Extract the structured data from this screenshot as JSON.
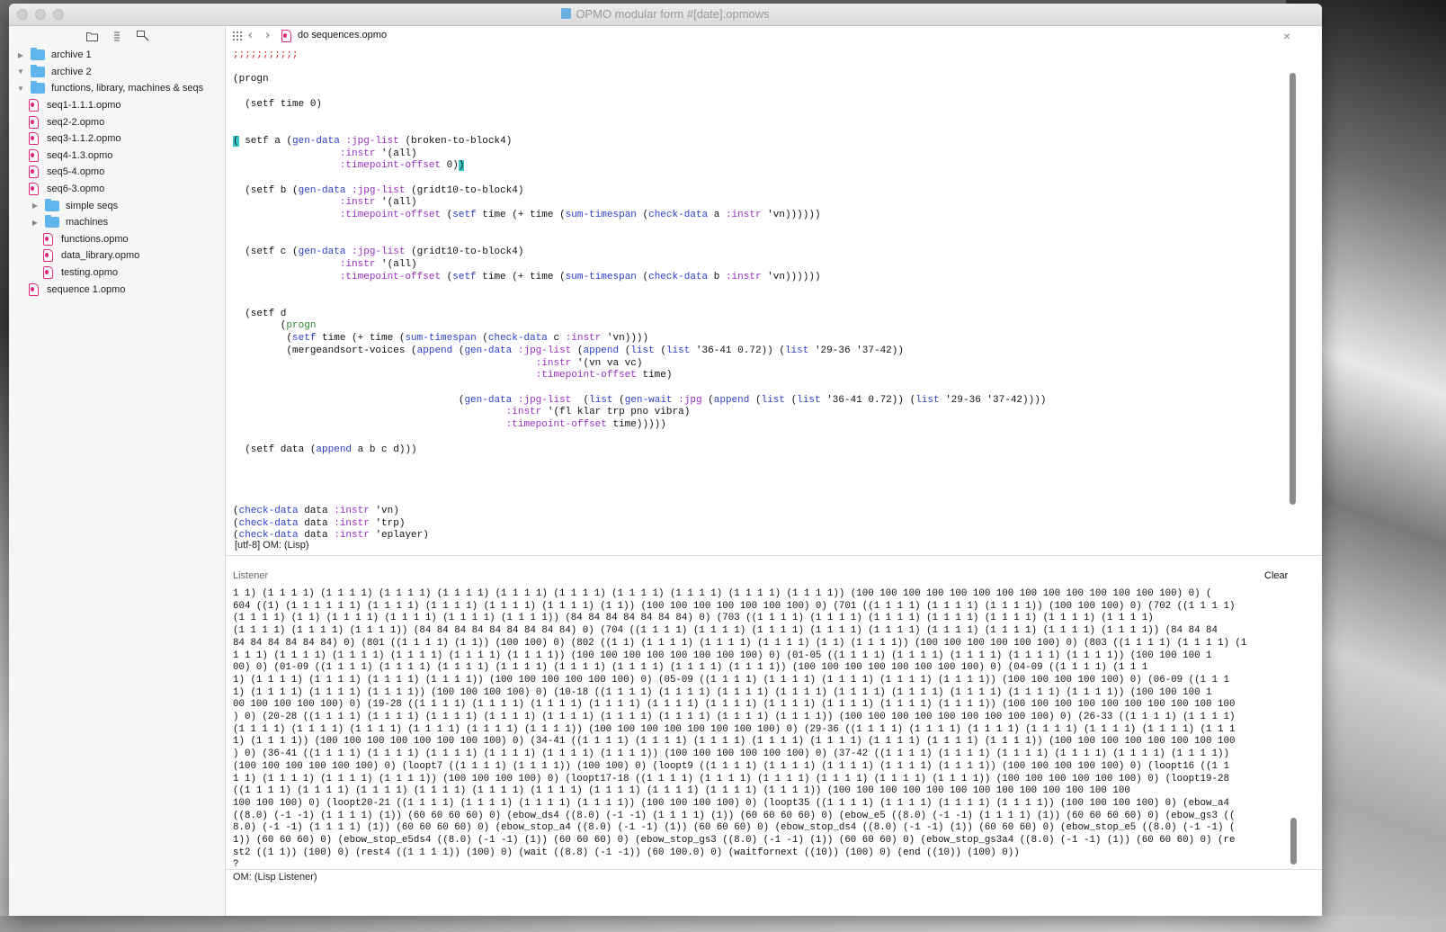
{
  "window": {
    "title": "OPMO modular form #[date].opmows"
  },
  "sidebar": {
    "tools": [
      "folder-icon",
      "list-icon",
      "search-icon"
    ],
    "items": [
      {
        "label": "archive 1",
        "type": "folder",
        "level": 0,
        "expanded": false
      },
      {
        "label": "archive 2",
        "type": "folder",
        "level": 0,
        "expanded": true
      },
      {
        "label": "functions, library, machines & seqs",
        "type": "folder",
        "level": 0,
        "expanded": true
      },
      {
        "label": "seq1-1.1.1.opmo",
        "type": "file",
        "level": 1
      },
      {
        "label": "seq2-2.opmo",
        "type": "file",
        "level": 1
      },
      {
        "label": "seq3-1.1.2.opmo",
        "type": "file",
        "level": 1
      },
      {
        "label": "seq4-1.3.opmo",
        "type": "file",
        "level": 1
      },
      {
        "label": "seq5-4.opmo",
        "type": "file",
        "level": 1
      },
      {
        "label": "seq6-3.opmo",
        "type": "file",
        "level": 1
      },
      {
        "label": "simple seqs",
        "type": "folder",
        "level": 1,
        "expanded": false
      },
      {
        "label": "machines",
        "type": "folder",
        "level": 1,
        "expanded": false
      },
      {
        "label": "functions.opmo",
        "type": "file",
        "level": 2
      },
      {
        "label": "data_library.opmo",
        "type": "file",
        "level": 2
      },
      {
        "label": "testing.opmo",
        "type": "file",
        "level": 2
      },
      {
        "label": "sequence 1.opmo",
        "type": "file",
        "level": 0
      }
    ]
  },
  "editor": {
    "tab_title": "do sequences.opmo",
    "status": "[utf-8] OM:  (Lisp)",
    "code_lines": [
      [
        [
          "red",
          ";;;;;;;;;;;"
        ]
      ],
      [],
      [
        [
          "",
          "(progn"
        ]
      ],
      [],
      [
        [
          "",
          "  (setf time 0)"
        ]
      ],
      [],
      [],
      [
        [
          "hl",
          "("
        ],
        [
          "",
          " setf a ("
        ],
        [
          "blue",
          "gen-data"
        ],
        [
          "",
          " "
        ],
        [
          "kw",
          ":jpg-list"
        ],
        [
          "",
          " (broken-to-block4)"
        ]
      ],
      [
        [
          "",
          "                  "
        ],
        [
          "kw",
          ":instr"
        ],
        [
          "",
          " '(all)"
        ]
      ],
      [
        [
          "",
          "                  "
        ],
        [
          "kw",
          ":timepoint-offset"
        ],
        [
          "",
          " 0)"
        ],
        [
          "hl",
          ")"
        ]
      ],
      [],
      [
        [
          "",
          "  (setf b ("
        ],
        [
          "blue",
          "gen-data"
        ],
        [
          "",
          " "
        ],
        [
          "kw",
          ":jpg-list"
        ],
        [
          "",
          " (gridt10-to-block4)"
        ]
      ],
      [
        [
          "",
          "                  "
        ],
        [
          "kw",
          ":instr"
        ],
        [
          "",
          " '(all)"
        ]
      ],
      [
        [
          "",
          "                  "
        ],
        [
          "kw",
          ":timepoint-offset"
        ],
        [
          "",
          " ("
        ],
        [
          "blue",
          "setf"
        ],
        [
          "",
          " time (+ time ("
        ],
        [
          "blue",
          "sum-timespan"
        ],
        [
          "",
          " ("
        ],
        [
          "blue",
          "check-data"
        ],
        [
          "",
          " a "
        ],
        [
          "kw",
          ":instr"
        ],
        [
          "",
          " 'vn))))))"
        ]
      ],
      [],
      [],
      [
        [
          "",
          "  (setf c ("
        ],
        [
          "blue",
          "gen-data"
        ],
        [
          "",
          " "
        ],
        [
          "kw",
          ":jpg-list"
        ],
        [
          "",
          " (gridt10-to-block4)"
        ]
      ],
      [
        [
          "",
          "                  "
        ],
        [
          "kw",
          ":instr"
        ],
        [
          "",
          " '(all)"
        ]
      ],
      [
        [
          "",
          "                  "
        ],
        [
          "kw",
          ":timepoint-offset"
        ],
        [
          "",
          " ("
        ],
        [
          "blue",
          "setf"
        ],
        [
          "",
          " time (+ time ("
        ],
        [
          "blue",
          "sum-timespan"
        ],
        [
          "",
          " ("
        ],
        [
          "blue",
          "check-data"
        ],
        [
          "",
          " b "
        ],
        [
          "kw",
          ":instr"
        ],
        [
          "",
          " 'vn))))))"
        ]
      ],
      [],
      [],
      [
        [
          "",
          "  (setf d"
        ]
      ],
      [
        [
          "",
          "        ("
        ],
        [
          "green",
          "progn"
        ]
      ],
      [
        [
          "",
          "         ("
        ],
        [
          "blue",
          "setf"
        ],
        [
          "",
          " time (+ time ("
        ],
        [
          "blue",
          "sum-timespan"
        ],
        [
          "",
          " ("
        ],
        [
          "blue",
          "check-data"
        ],
        [
          "",
          " c "
        ],
        [
          "kw",
          ":instr"
        ],
        [
          "",
          " 'vn))))"
        ]
      ],
      [
        [
          "",
          "         (mergeandsort-voices ("
        ],
        [
          "blue",
          "append"
        ],
        [
          "",
          " ("
        ],
        [
          "blue",
          "gen-data"
        ],
        [
          "",
          " "
        ],
        [
          "kw",
          ":jpg-list"
        ],
        [
          "",
          " ("
        ],
        [
          "blue",
          "append"
        ],
        [
          "",
          " ("
        ],
        [
          "blue",
          "list"
        ],
        [
          "",
          " ("
        ],
        [
          "blue",
          "list"
        ],
        [
          "",
          " '36-41 0.72)) ("
        ],
        [
          "blue",
          "list"
        ],
        [
          "",
          " '29-36 '37-42))"
        ]
      ],
      [
        [
          "",
          "                                                   "
        ],
        [
          "kw",
          ":instr"
        ],
        [
          "",
          " '(vn va vc)"
        ]
      ],
      [
        [
          "",
          "                                                   "
        ],
        [
          "kw",
          ":timepoint-offset"
        ],
        [
          "",
          " time)"
        ]
      ],
      [],
      [
        [
          "",
          "                                      ("
        ],
        [
          "blue",
          "gen-data"
        ],
        [
          "",
          " "
        ],
        [
          "kw",
          ":jpg-list"
        ],
        [
          "",
          "  ("
        ],
        [
          "blue",
          "list"
        ],
        [
          "",
          " ("
        ],
        [
          "blue",
          "gen-wait"
        ],
        [
          "",
          " "
        ],
        [
          "kw",
          ":jpg"
        ],
        [
          "",
          " ("
        ],
        [
          "blue",
          "append"
        ],
        [
          "",
          " ("
        ],
        [
          "blue",
          "list"
        ],
        [
          "",
          " ("
        ],
        [
          "blue",
          "list"
        ],
        [
          "",
          " '36-41 0.72)) ("
        ],
        [
          "blue",
          "list"
        ],
        [
          "",
          " '29-36 '37-42))))"
        ]
      ],
      [
        [
          "",
          "                                              "
        ],
        [
          "kw",
          ":instr"
        ],
        [
          "",
          " '(fl klar trp pno vibra)"
        ]
      ],
      [
        [
          "",
          "                                              "
        ],
        [
          "kw",
          ":timepoint-offset"
        ],
        [
          "",
          " time)))))"
        ]
      ],
      [],
      [
        [
          "",
          "  (setf data ("
        ],
        [
          "blue",
          "append"
        ],
        [
          "",
          " a b c d)))"
        ]
      ],
      [],
      [],
      [],
      [],
      [
        [
          "",
          "("
        ],
        [
          "blue",
          "check-data"
        ],
        [
          "",
          " data "
        ],
        [
          "kw",
          ":instr"
        ],
        [
          "",
          " 'vn)"
        ]
      ],
      [
        [
          "",
          "("
        ],
        [
          "blue",
          "check-data"
        ],
        [
          "",
          " data "
        ],
        [
          "kw",
          ":instr"
        ],
        [
          "",
          " 'trp)"
        ]
      ],
      [
        [
          "",
          "("
        ],
        [
          "blue",
          "check-data"
        ],
        [
          "",
          " data "
        ],
        [
          "kw",
          ":instr"
        ],
        [
          "",
          " 'eplayer)"
        ]
      ]
    ]
  },
  "listener": {
    "title": "Listener",
    "clear_label": "Clear",
    "status": "OM:  (Lisp Listener)",
    "output": "1 1) (1 1 1 1) (1 1 1 1) (1 1 1 1) (1 1 1 1) (1 1 1 1) (1 1 1 1) (1 1 1 1) (1 1 1 1) (1 1 1 1) (1 1 1 1)) (100 100 100 100 100 100 100 100 100 100 100 100 100 100) 0) (\n604 ((1) (1 1 1 1 1 1) (1 1 1 1) (1 1 1 1) (1 1 1 1) (1 1 1 1) (1 1)) (100 100 100 100 100 100 100) 0) (701 ((1 1 1 1) (1 1 1 1) (1 1 1 1)) (100 100 100) 0) (702 ((1 1 1 1)\n(1 1 1 1) (1 1) (1 1 1 1) (1 1 1 1) (1 1 1 1) (1 1 1 1)) (84 84 84 84 84 84 84) 0) (703 ((1 1 1 1) (1 1 1 1) (1 1 1 1) (1 1 1 1) (1 1 1 1) (1 1 1 1) (1 1 1 1)\n(1 1 1 1) (1 1 1 1) (1 1 1 1)) (84 84 84 84 84 84 84 84 84) 0) (704 ((1 1 1 1) (1 1 1 1) (1 1 1 1) (1 1 1 1) (1 1 1 1) (1 1 1 1) (1 1 1 1) (1 1 1 1) (1 1 1 1)) (84 84 84\n84 84 84 84 84 84) 0) (801 ((1 1 1 1) (1 1)) (100 100) 0) (802 ((1 1) (1 1 1 1) (1 1 1 1) (1 1 1 1) (1 1) (1 1 1 1)) (100 100 100 100 100 100) 0) (803 ((1 1 1 1) (1 1 1 1) (1\n1 1 1) (1 1 1 1) (1 1 1 1) (1 1 1 1) (1 1 1 1) (1 1 1 1)) (100 100 100 100 100 100 100 100) 0) (01-05 ((1 1 1 1) (1 1 1 1) (1 1 1 1) (1 1 1 1) (1 1 1 1)) (100 100 100 1\n00) 0) (01-09 ((1 1 1 1) (1 1 1 1) (1 1 1 1) (1 1 1 1) (1 1 1 1) (1 1 1 1) (1 1 1 1) (1 1 1 1)) (100 100 100 100 100 100 100 100) 0) (04-09 ((1 1 1 1) (1 1 1\n1) (1 1 1 1) (1 1 1 1) (1 1 1 1) (1 1 1 1)) (100 100 100 100 100 100) 0) (05-09 ((1 1 1 1) (1 1 1 1) (1 1 1 1) (1 1 1 1) (1 1 1 1)) (100 100 100 100 100) 0) (06-09 ((1 1 1\n1) (1 1 1 1) (1 1 1 1) (1 1 1 1)) (100 100 100 100) 0) (10-18 ((1 1 1 1) (1 1 1 1) (1 1 1 1) (1 1 1 1) (1 1 1 1) (1 1 1 1) (1 1 1 1) (1 1 1 1) (1 1 1 1)) (100 100 100 1\n00 100 100 100 100) 0) (19-28 ((1 1 1 1) (1 1 1 1) (1 1 1 1) (1 1 1 1) (1 1 1 1) (1 1 1 1) (1 1 1 1) (1 1 1 1) (1 1 1 1) (1 1 1 1)) (100 100 100 100 100 100 100 100 100 100\n) 0) (20-28 ((1 1 1 1) (1 1 1 1) (1 1 1 1) (1 1 1 1) (1 1 1 1) (1 1 1 1) (1 1 1 1) (1 1 1 1) (1 1 1 1)) (100 100 100 100 100 100 100 100 100) 0) (26-33 ((1 1 1 1) (1 1 1 1)\n(1 1 1 1) (1 1 1 1) (1 1 1 1) (1 1 1 1) (1 1 1 1) (1 1 1 1)) (100 100 100 100 100 100 100 100) 0) (29-36 ((1 1 1 1) (1 1 1 1) (1 1 1 1) (1 1 1 1) (1 1 1 1) (1 1 1 1) (1 1 1\n1) (1 1 1 1)) (100 100 100 100 100 100 100 100) 0) (34-41 ((1 1 1 1) (1 1 1 1) (1 1 1 1) (1 1 1 1) (1 1 1 1) (1 1 1 1) (1 1 1 1) (1 1 1 1)) (100 100 100 100 100 100 100 100\n) 0) (36-41 ((1 1 1 1) (1 1 1 1) (1 1 1 1) (1 1 1 1) (1 1 1 1) (1 1 1 1)) (100 100 100 100 100 100) 0) (37-42 ((1 1 1 1) (1 1 1 1) (1 1 1 1) (1 1 1 1) (1 1 1 1) (1 1 1 1))\n(100 100 100 100 100 100) 0) (loopt7 ((1 1 1 1) (1 1 1 1)) (100 100) 0) (loopt9 ((1 1 1 1) (1 1 1 1) (1 1 1 1) (1 1 1 1) (1 1 1 1)) (100 100 100 100 100) 0) (loopt16 ((1 1\n1 1) (1 1 1 1) (1 1 1 1) (1 1 1 1)) (100 100 100 100) 0) (loopt17-18 ((1 1 1 1) (1 1 1 1) (1 1 1 1) (1 1 1 1) (1 1 1 1) (1 1 1 1)) (100 100 100 100 100 100) 0) (loopt19-28\n((1 1 1 1) (1 1 1 1) (1 1 1 1) (1 1 1 1) (1 1 1 1) (1 1 1 1) (1 1 1 1) (1 1 1 1) (1 1 1 1) (1 1 1 1)) (100 100 100 100 100 100 100 100 100 100 100 100 100\n100 100 100) 0) (loopt20-21 ((1 1 1 1) (1 1 1 1) (1 1 1 1) (1 1 1 1)) (100 100 100 100) 0) (loopt35 ((1 1 1 1) (1 1 1 1) (1 1 1 1) (1 1 1 1)) (100 100 100 100) 0) (ebow_a4\n((8.0) (-1 -1) (1 1 1 1) (1)) (60 60 60 60) 0) (ebow_ds4 ((8.0) (-1 -1) (1 1 1 1) (1)) (60 60 60 60) 0) (ebow_e5 ((8.0) (-1 -1) (1 1 1 1) (1)) (60 60 60 60) 0) (ebow_gs3 ((\n8.0) (-1 -1) (1 1 1 1) (1)) (60 60 60 60) 0) (ebow_stop_a4 ((8.0) (-1 -1) (1)) (60 60 60) 0) (ebow_stop_ds4 ((8.0) (-1 -1) (1)) (60 60 60) 0) (ebow_stop_e5 ((8.0) (-1 -1) (\n1)) (60 60 60) 0) (ebow_stop_e5ds4 ((8.0) (-1 -1) (1)) (60 60 60) 0) (ebow_stop_gs3 ((8.0) (-1 -1) (1)) (60 60 60) 0) (ebow_stop_gs3a4 ((8.0) (-1 -1) (1)) (60 60 60) 0) (re\nst2 ((1 1)) (100) 0) (rest4 ((1 1 1 1)) (100) 0) (wait ((8.8) (-1 -1)) (60 100.0) 0) (waitfornext ((10)) (100) 0) (end ((10)) (100) 0))\n?"
  },
  "colors": {
    "red": "#d12a2a",
    "green": "#2b8a2b",
    "blue": "#2a3fc4",
    "keyword": "#9a2fc1",
    "highlight": "#33c8c8",
    "folder": "#5fb6ec",
    "file": "#e0247a"
  }
}
